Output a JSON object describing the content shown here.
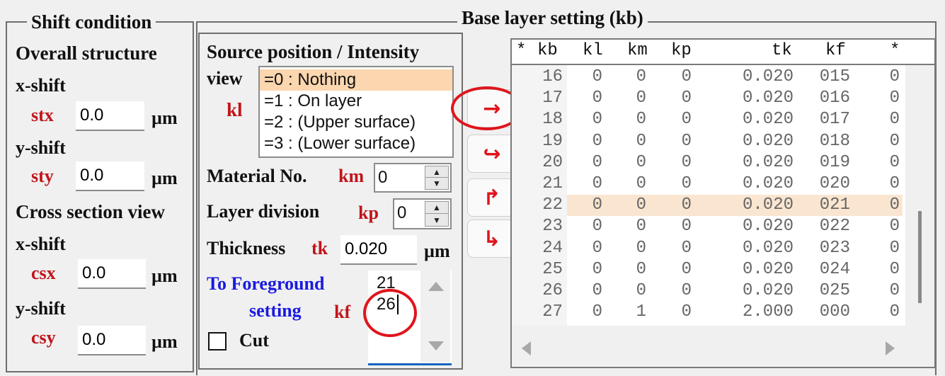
{
  "shift_condition": {
    "title": "Shift condition",
    "overall_structure_label": "Overall structure",
    "overall": {
      "x_shift_label": "x-shift",
      "stx_label": "stx",
      "stx_value": "0.0",
      "y_shift_label": "y-shift",
      "sty_label": "sty",
      "sty_value": "0.0"
    },
    "cross_section_label": "Cross section view",
    "cross": {
      "x_shift_label": "x-shift",
      "csx_label": "csx",
      "csx_value": "0.0",
      "y_shift_label": "y-shift",
      "csy_label": "csy",
      "csy_value": "0.0"
    },
    "unit": "µm"
  },
  "base_layer": {
    "title": "Base layer setting (kb)",
    "source": {
      "title": "Source position / Intensity",
      "view_label": "view",
      "kl_label": "kl",
      "options": [
        "=0 : Nothing",
        "=1 : On layer",
        "=2 : (Upper surface)",
        "=3 : (Lower surface)"
      ],
      "selected_index": 0
    },
    "material": {
      "label": "Material No.",
      "code": "km",
      "value": "0"
    },
    "layer_division": {
      "label": "Layer division",
      "code": "kp",
      "value": "0"
    },
    "thickness": {
      "label": "Thickness",
      "code": "tk",
      "value": "0.020",
      "unit": "µm"
    },
    "foreground": {
      "label_line1": "To Foreground",
      "label_line2": "setting",
      "code": "kf",
      "lines": [
        "21",
        "26"
      ]
    },
    "cut": {
      "label": "Cut",
      "checked": false
    },
    "buttons": [
      {
        "name": "arrow-right",
        "glyph": "→"
      },
      {
        "name": "insert",
        "glyph": "↪"
      },
      {
        "name": "up-right",
        "glyph": "↱"
      },
      {
        "name": "down-right",
        "glyph": "↳"
      }
    ],
    "table": {
      "headers": [
        "*",
        "kb",
        "kl",
        "km",
        "kp",
        "tk",
        "kf",
        "*"
      ],
      "selected_kb": "22",
      "rows": [
        {
          "kb": "16",
          "kl": "0",
          "km": "0",
          "kp": "0",
          "tk": "0.020",
          "kf": "015",
          "x": "0"
        },
        {
          "kb": "17",
          "kl": "0",
          "km": "0",
          "kp": "0",
          "tk": "0.020",
          "kf": "016",
          "x": "0"
        },
        {
          "kb": "18",
          "kl": "0",
          "km": "0",
          "kp": "0",
          "tk": "0.020",
          "kf": "017",
          "x": "0"
        },
        {
          "kb": "19",
          "kl": "0",
          "km": "0",
          "kp": "0",
          "tk": "0.020",
          "kf": "018",
          "x": "0"
        },
        {
          "kb": "20",
          "kl": "0",
          "km": "0",
          "kp": "0",
          "tk": "0.020",
          "kf": "019",
          "x": "0"
        },
        {
          "kb": "21",
          "kl": "0",
          "km": "0",
          "kp": "0",
          "tk": "0.020",
          "kf": "020",
          "x": "0"
        },
        {
          "kb": "22",
          "kl": "0",
          "km": "0",
          "kp": "0",
          "tk": "0.020",
          "kf": "021",
          "x": "0"
        },
        {
          "kb": "23",
          "kl": "0",
          "km": "0",
          "kp": "0",
          "tk": "0.020",
          "kf": "022",
          "x": "0"
        },
        {
          "kb": "24",
          "kl": "0",
          "km": "0",
          "kp": "0",
          "tk": "0.020",
          "kf": "023",
          "x": "0"
        },
        {
          "kb": "25",
          "kl": "0",
          "km": "0",
          "kp": "0",
          "tk": "0.020",
          "kf": "024",
          "x": "0"
        },
        {
          "kb": "26",
          "kl": "0",
          "km": "0",
          "kp": "0",
          "tk": "0.020",
          "kf": "025",
          "x": "0"
        },
        {
          "kb": "27",
          "kl": "0",
          "km": "1",
          "kp": "0",
          "tk": "2.000",
          "kf": "000",
          "x": "0"
        }
      ]
    }
  },
  "colors": {
    "code_label": "#c0141b",
    "foreground_label": "#1a1ae0",
    "selection": "#fbd6ae",
    "annotation": "#e0141b"
  }
}
